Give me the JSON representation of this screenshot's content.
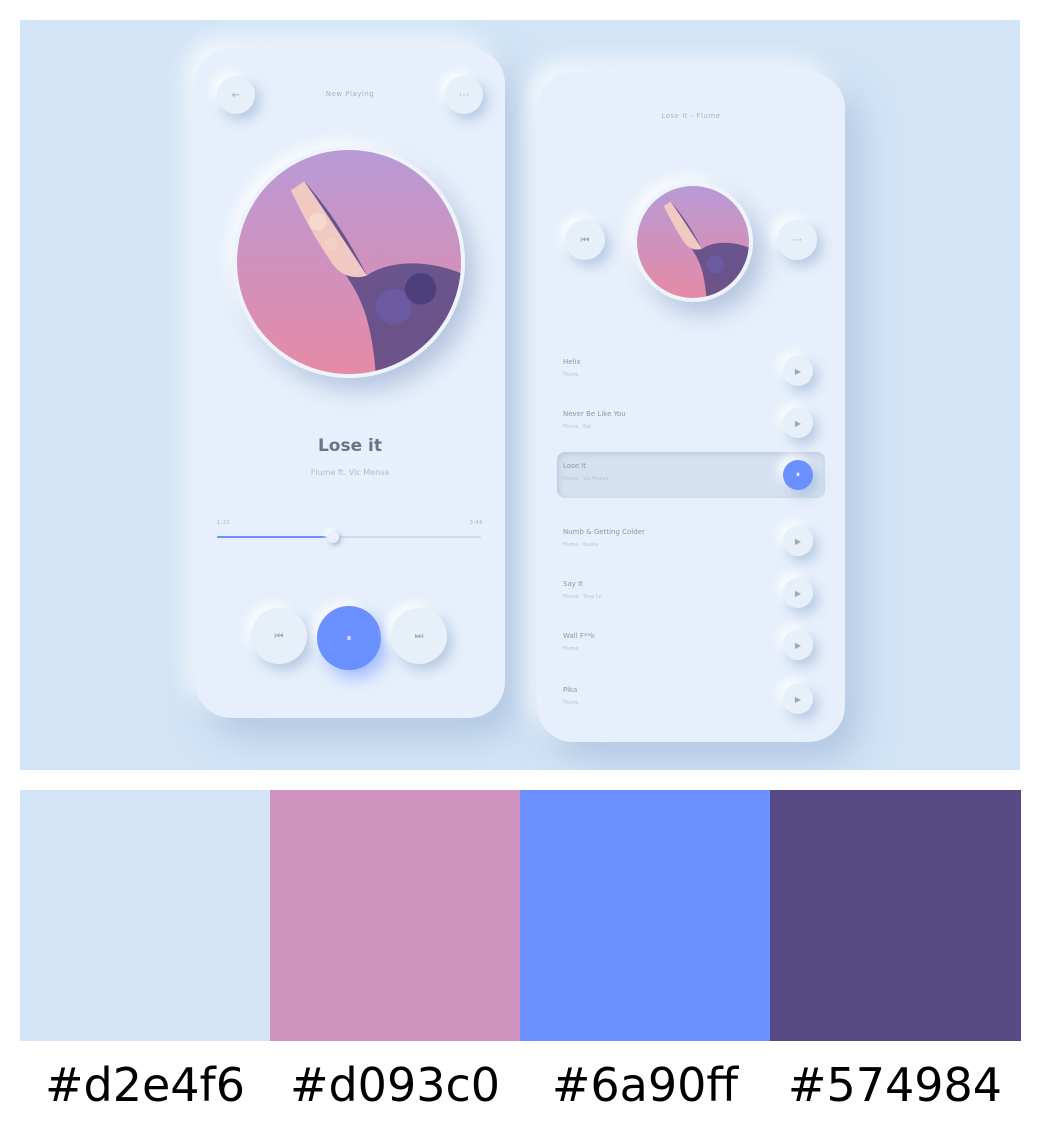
{
  "player": {
    "header_title": "Now Playing",
    "back_icon": "back-arrow-icon",
    "menu_icon": "menu-dots-icon",
    "song_title": "Lose it",
    "song_artist": "Flume ft. Vic Mensa",
    "time_elapsed": "1:21",
    "time_total": "3:46",
    "progress": 0.44,
    "controls": [
      "previous-icon",
      "pause-icon",
      "next-icon"
    ]
  },
  "playlist": {
    "header_title": "Lose It - Flume",
    "tracks": [
      {
        "name": "Helix",
        "sub": "Flume"
      },
      {
        "name": "Never Be Like You",
        "sub": "Flume · Kai"
      },
      {
        "name": "Lose It",
        "sub": "Flume · Vic Mensa",
        "active": true
      },
      {
        "name": "Numb & Getting Colder",
        "sub": "Flume · Kucka"
      },
      {
        "name": "Say It",
        "sub": "Flume · Tove Lo"
      },
      {
        "name": "Wall F**k",
        "sub": "Flume"
      },
      {
        "name": "Pika",
        "sub": "Flume"
      }
    ]
  },
  "palette": [
    {
      "hex": "#d2e4f6",
      "label": "#d2e4f6"
    },
    {
      "hex": "#d093c0",
      "label": "#d093c0"
    },
    {
      "hex": "#6a90ff",
      "label": "#6a90ff"
    },
    {
      "hex": "#574984",
      "label": "#574984"
    }
  ]
}
